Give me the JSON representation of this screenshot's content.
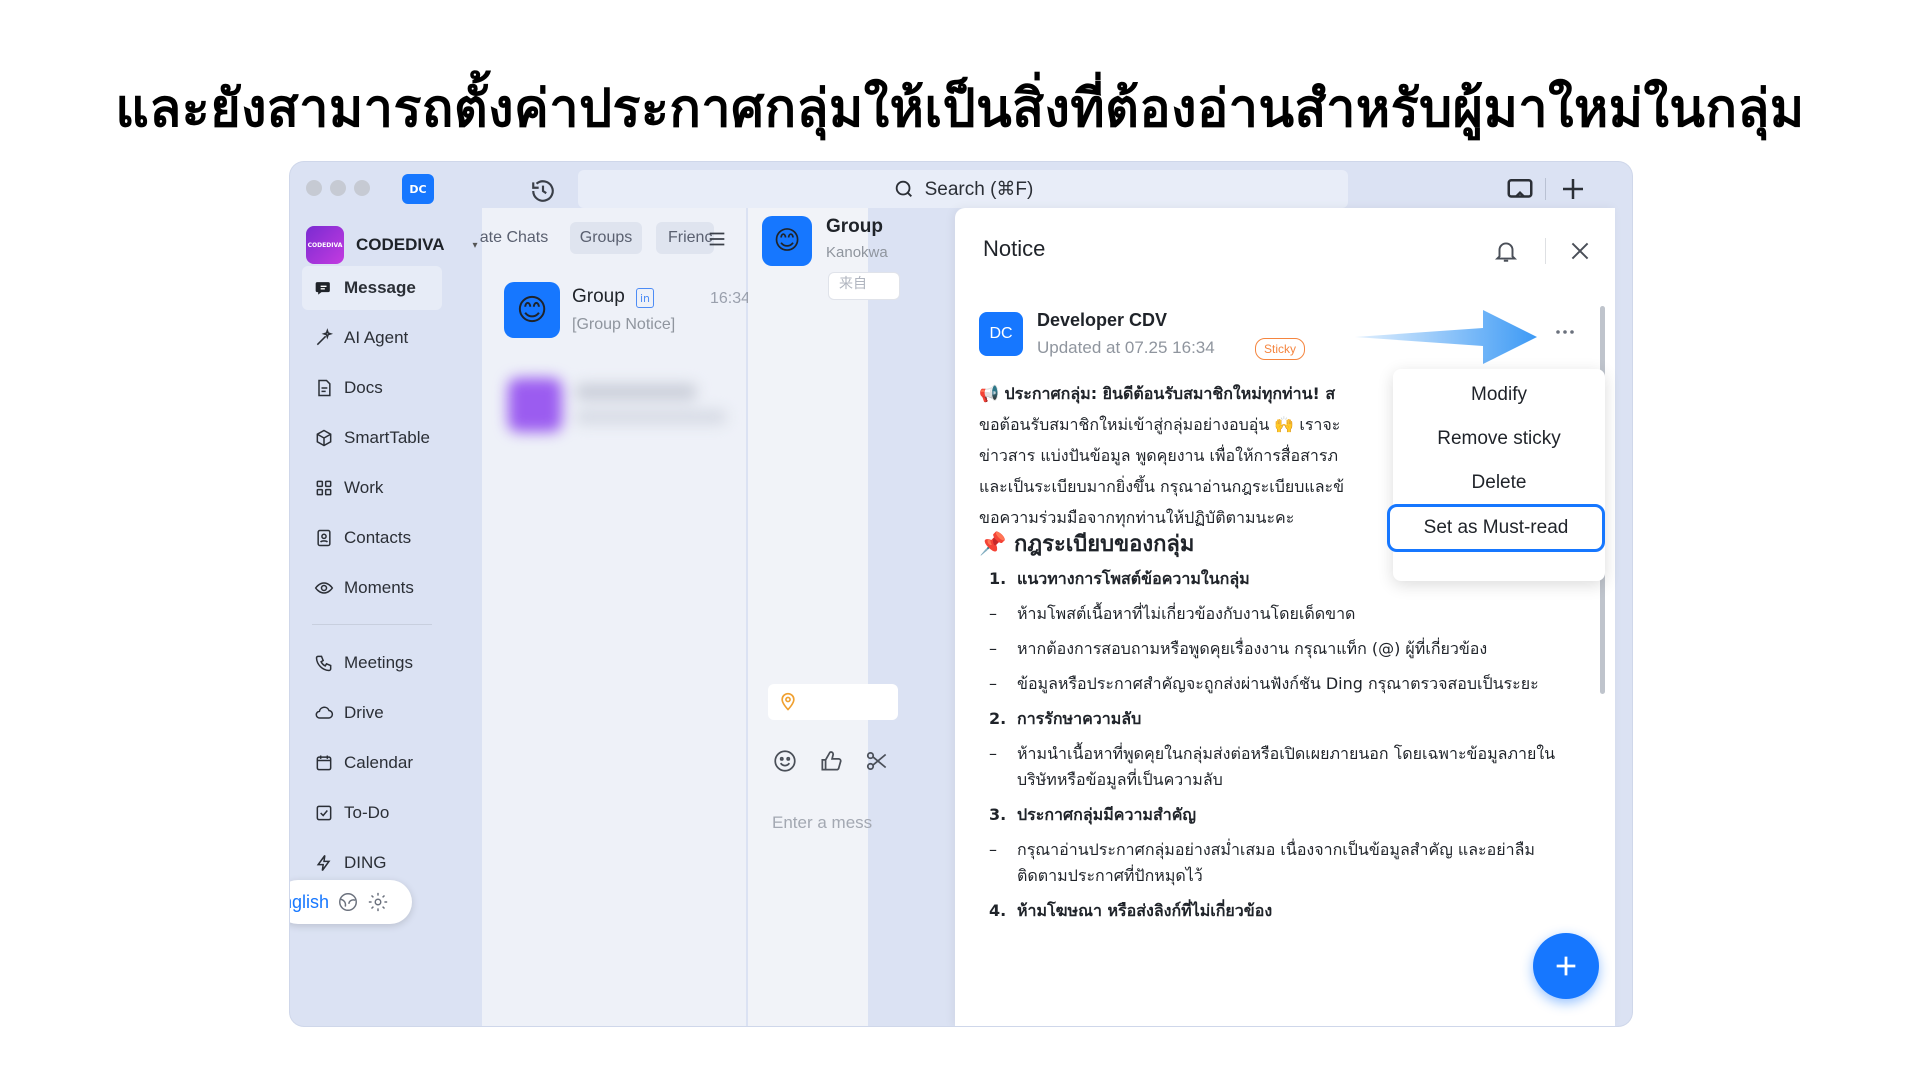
{
  "caption": "และยังสามารถตั้งค่าประกาศกลุ่มให้เป็นสิ่งที่ต้องอ่านสำหรับผู้มาใหม่ในกลุ่ม",
  "titlebar": {
    "user_badge": "DC",
    "search_placeholder": "Search (⌘F)"
  },
  "org": {
    "logo_text": "CODEDIVA",
    "name": "CODEDIVA"
  },
  "sidebar": {
    "items": [
      {
        "label": "Message",
        "icon": "message-icon"
      },
      {
        "label": "AI Agent",
        "icon": "ai-agent-icon"
      },
      {
        "label": "Docs",
        "icon": "docs-icon"
      },
      {
        "label": "SmartTable",
        "icon": "smarttable-icon"
      },
      {
        "label": "Work",
        "icon": "work-icon"
      },
      {
        "label": "Contacts",
        "icon": "contacts-icon"
      },
      {
        "label": "Moments",
        "icon": "moments-icon"
      },
      {
        "label": "Meetings",
        "icon": "meetings-icon"
      },
      {
        "label": "Drive",
        "icon": "drive-icon"
      },
      {
        "label": "Calendar",
        "icon": "calendar-icon"
      },
      {
        "label": "To-Do",
        "icon": "todo-icon"
      },
      {
        "label": "DING",
        "icon": "ding-icon"
      }
    ],
    "language": "nglish"
  },
  "list": {
    "tabs": [
      "ate Chats",
      "Groups",
      "Frienc"
    ],
    "conversation": {
      "name": "Group",
      "badge": "in",
      "time": "16:34",
      "preview": "[Group Notice]"
    }
  },
  "chat": {
    "title": "Group",
    "subtitle": "Kanokwa",
    "bubble": "来自",
    "input_placeholder": "Enter a mess"
  },
  "notice": {
    "title": "Notice",
    "author_avatar": "DC",
    "author": "Developer CDV",
    "updated": "Updated at 07.25 16:34",
    "sticky": "Sticky",
    "intro": [
      "📢 ประกาศกลุ่ม: ยินดีต้อนรับสมาชิกใหม่ทุกท่าน! ส",
      "ขอต้อนรับสมาชิกใหม่เข้าสู่กลุ่มอย่างอบอุ่น 🙌 เราจะ",
      "ข่าวสาร แบ่งปันข้อมูล พูดคุยงาน เพื่อให้การสื่อสารภ",
      "และเป็นระเบียบมากยิ่งขึ้น กรุณาอ่านกฎระเบียบและข้",
      "ขอความร่วมมือจากทุกท่านให้ปฏิบัติตามนะคะ"
    ],
    "rules_heading": "📌 กฎระเบียบของกลุ่ม",
    "rules": [
      {
        "marker": "1.",
        "text": "แนวทางการโพสต์ข้อความในกลุ่ม",
        "heading": true
      },
      {
        "marker": "–",
        "text": "ห้ามโพสต์เนื้อหาที่ไม่เกี่ยวข้องกับงานโดยเด็ดขาด",
        "heading": false
      },
      {
        "marker": "–",
        "text": "หากต้องการสอบถามหรือพูดคุยเรื่องงาน กรุณาแท็ก (@) ผู้ที่เกี่ยวข้อง",
        "heading": false
      },
      {
        "marker": "–",
        "text": "ข้อมูลหรือประกาศสำคัญจะถูกส่งผ่านฟังก์ชัน Ding กรุณาตรวจสอบเป็นระยะ",
        "heading": false
      },
      {
        "marker": "2.",
        "text": "การรักษาความลับ",
        "heading": true
      },
      {
        "marker": "–",
        "text": "ห้ามนำเนื้อหาที่พูดคุยในกลุ่มส่งต่อหรือเปิดเผยภายนอก โดยเฉพาะข้อมูลภายในบริษัทหรือข้อมูลที่เป็นความลับ",
        "heading": false
      },
      {
        "marker": "3.",
        "text": "ประกาศกลุ่มมีความสำคัญ",
        "heading": true
      },
      {
        "marker": "–",
        "text": "กรุณาอ่านประกาศกลุ่มอย่างสม่ำเสมอ เนื่องจากเป็นข้อมูลสำคัญ และอย่าลืมติดตามประกาศที่ปักหมุดไว้",
        "heading": false
      },
      {
        "marker": "4.",
        "text": "ห้ามโฆษณา หรือส่งลิงก์ที่ไม่เกี่ยวข้อง",
        "heading": true
      }
    ]
  },
  "context_menu": {
    "modify": "Modify",
    "remove_sticky": "Remove sticky",
    "delete": "Delete",
    "must_read": "Set as Must-read"
  },
  "colors": {
    "accent": "#1677ff",
    "sticky": "#f5853f",
    "sidebar_bg": "#dbe2f3",
    "arrow": "#3d9af5"
  }
}
